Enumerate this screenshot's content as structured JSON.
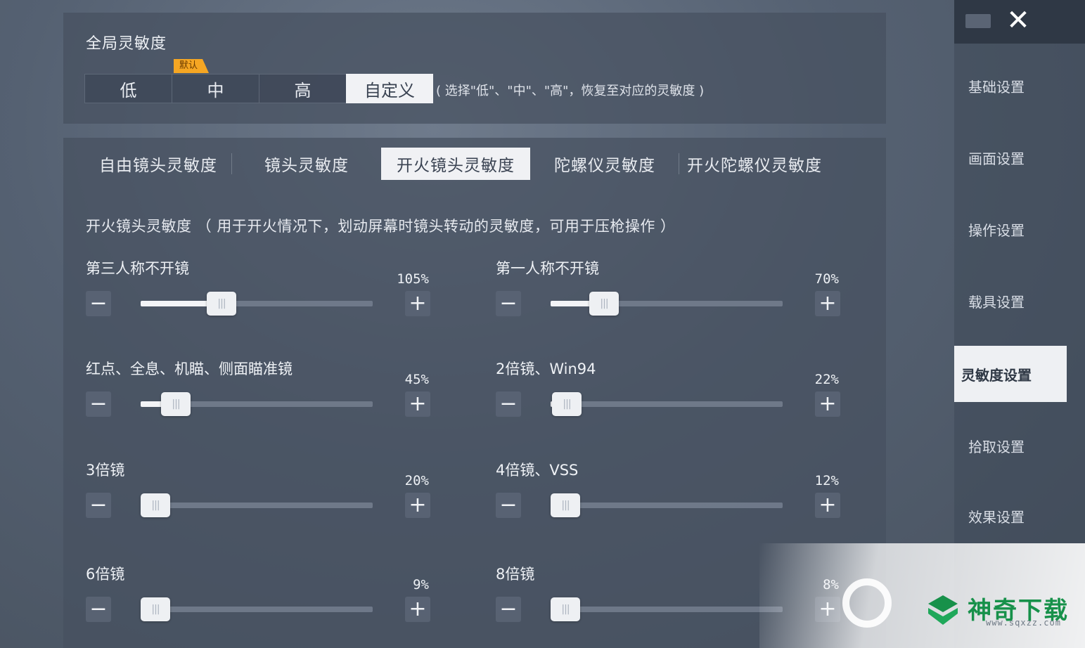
{
  "global": {
    "title": "全局灵敏度",
    "presets": [
      {
        "label": "低",
        "active": false
      },
      {
        "label": "中",
        "active": false,
        "badge": "默认"
      },
      {
        "label": "高",
        "active": false
      },
      {
        "label": "自定义",
        "active": true
      }
    ],
    "hint": "( 选择\"低\"、\"中\"、\"高\"，恢复至对应的灵敏度 )"
  },
  "tabs": [
    {
      "label": "自由镜头灵敏度",
      "active": false
    },
    {
      "label": "镜头灵敏度",
      "active": false
    },
    {
      "label": "开火镜头灵敏度",
      "active": true
    },
    {
      "label": "陀螺仪灵敏度",
      "active": false
    },
    {
      "label": "开火陀螺仪灵敏度",
      "active": false
    }
  ],
  "description": "开火镜头灵敏度 （ 用于开火情况下，划动屏幕时镜头转动的灵敏度，可用于压枪操作 ）",
  "controls": {
    "minus": "−",
    "plus": "+",
    "grip": "|||"
  },
  "sliders": [
    {
      "label": "第三人称不开镜",
      "value": "105%",
      "position": 0.35
    },
    {
      "label": "第一人称不开镜",
      "value": "70%",
      "position": 0.23
    },
    {
      "label": "红点、全息、机瞄、侧面瞄准镜",
      "value": "45%",
      "position": 0.15
    },
    {
      "label": "2倍镜、Win94",
      "value": "22%",
      "position": 0.07
    },
    {
      "label": "3倍镜",
      "value": "20%",
      "position": 0.06
    },
    {
      "label": "4倍镜、VSS",
      "value": "12%",
      "position": 0.03
    },
    {
      "label": "6倍镜",
      "value": "9%",
      "position": 0.02
    },
    {
      "label": "8倍镜",
      "value": "8%",
      "position": 0.01
    }
  ],
  "sidebar": {
    "close": "✕",
    "items": [
      {
        "label": "基础设置",
        "active": false
      },
      {
        "label": "画面设置",
        "active": false
      },
      {
        "label": "操作设置",
        "active": false
      },
      {
        "label": "载具设置",
        "active": false
      },
      {
        "label": "灵敏度设置",
        "active": true
      },
      {
        "label": "拾取设置",
        "active": false
      },
      {
        "label": "效果设置",
        "active": false
      }
    ]
  },
  "watermark": {
    "brand": "神奇下载",
    "url": "www.sqxzz.com",
    "brand_color": "#17914a"
  }
}
